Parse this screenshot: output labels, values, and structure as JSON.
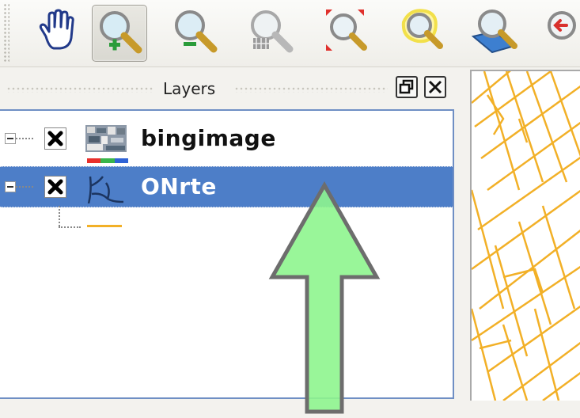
{
  "toolbar": {
    "tools": [
      {
        "name": "pan-tool",
        "icon": "pan-hand-icon"
      },
      {
        "name": "zoom-in-tool",
        "icon": "zoom-in-icon",
        "active": true
      },
      {
        "name": "zoom-out-tool",
        "icon": "zoom-out-icon"
      },
      {
        "name": "zoom-native-resolution-tool",
        "icon": "zoom-native-icon"
      },
      {
        "name": "zoom-full-extent-tool",
        "icon": "zoom-full-icon"
      },
      {
        "name": "zoom-to-selection-tool",
        "icon": "zoom-selection-icon"
      },
      {
        "name": "zoom-to-layer-tool",
        "icon": "zoom-layer-icon"
      },
      {
        "name": "zoom-last-tool",
        "icon": "zoom-last-icon"
      }
    ]
  },
  "panel": {
    "title": "Layers",
    "float_button_icon": "float-window-icon",
    "close_button_icon": "close-icon"
  },
  "layers": [
    {
      "name": "bingimage",
      "checked": true,
      "selected": false,
      "icon": "raster-image-icon",
      "legend_colors": [
        "#e8302c",
        "#39b54a",
        "#2f63d6"
      ]
    },
    {
      "name": "ONrte",
      "checked": true,
      "selected": true,
      "icon": "vector-line-icon",
      "legend_color": "#f2b027"
    }
  ],
  "colors": {
    "selection": "#4d7ec8",
    "road": "#f2b027",
    "annotation_arrow": "#8ef58e"
  }
}
